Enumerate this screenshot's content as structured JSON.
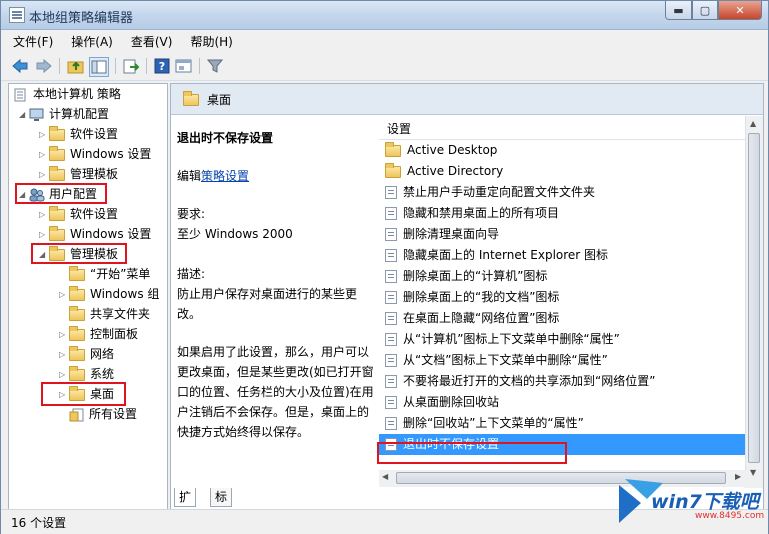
{
  "window": {
    "title": "本地组策略编辑器"
  },
  "menu": [
    "文件(F)",
    "操作(A)",
    "查看(V)",
    "帮助(H)"
  ],
  "tree": {
    "root": "本地计算机 策略",
    "computer_config": "计算机配置",
    "cc_software": "软件设置",
    "cc_windows": "Windows 设置",
    "cc_admin": "管理模板",
    "user_config": "用户配置",
    "uc_software": "软件设置",
    "uc_windows": "Windows 设置",
    "uc_admin": "管理模板",
    "start_menu": "“开始”菜单",
    "windows_components": "Windows 组",
    "shared_folders": "共享文件夹",
    "control_panel": "控制面板",
    "network": "网络",
    "system": "系统",
    "desktop": "桌面",
    "all_settings": "所有设置"
  },
  "detail": {
    "header": "桌面",
    "setting_title": "退出时不保存设置",
    "edit_prefix": "编辑",
    "edit_link": "策略设置",
    "requirements_label": "要求:",
    "requirements_value": "至少 Windows 2000",
    "description_label": "描述:",
    "description_1": "防止用户保存对桌面进行的某些更改。",
    "description_2": "如果启用了此设置，那么，用户可以更改桌面，但是某些更改(如已打开窗口的位置、任务栏的大小及位置)在用户注销后不会保存。但是，桌面上的快捷方式始终得以保存。"
  },
  "list": {
    "column": "设置",
    "items": [
      "Active Desktop",
      "Active Directory",
      "禁止用户手动重定向配置文件文件夹",
      "隐藏和禁用桌面上的所有项目",
      "删除清理桌面向导",
      "隐藏桌面上的 Internet Explorer 图标",
      "删除桌面上的“计算机”图标",
      "删除桌面上的“我的文档”图标",
      "在桌面上隐藏“网络位置”图标",
      "从“计算机”图标上下文菜单中删除“属性”",
      "从“文档”图标上下文菜单中删除“属性”",
      "不要将最近打开的文档的共享添加到“网络位置”",
      "从桌面删除回收站",
      "删除“回收站”上下文菜单的“属性”",
      "退出时不保存设置"
    ]
  },
  "tabs": [
    "扩展",
    "标准"
  ],
  "status": "16 个设置",
  "watermark": {
    "brand": "win7下载吧",
    "url": "www.8495.com"
  }
}
